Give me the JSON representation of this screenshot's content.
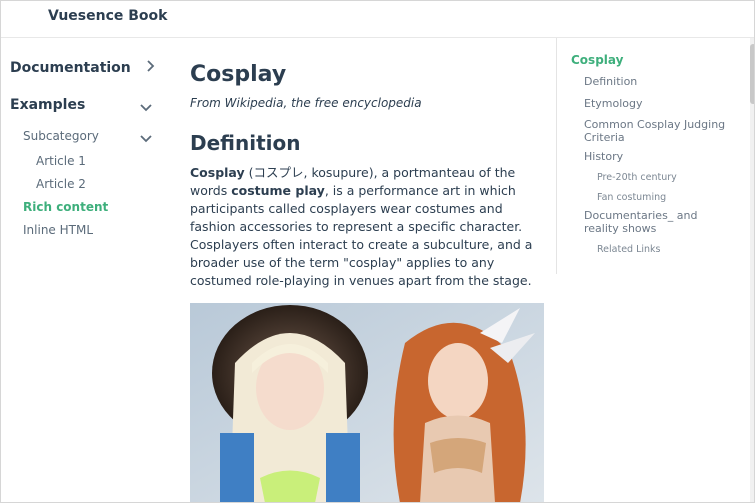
{
  "app": {
    "title": "Vuesence Book"
  },
  "sidebar": {
    "documentation": "Documentation",
    "examples": "Examples",
    "subcategory": "Subcategory",
    "article1": "Article 1",
    "article2": "Article 2",
    "rich_content": "Rich content",
    "inline_html": "Inline HTML"
  },
  "content": {
    "title": "Cosplay",
    "subtitle": "From Wikipedia, the free encyclopedia",
    "heading": "Definition",
    "p_bold1": "Cosplay",
    "p_text1": " (コスプレ, kosupure), a portmanteau of the words ",
    "p_bold2": "costume play",
    "p_text2": ", is a performance art in which participants called cosplayers wear costumes and fashion accessories to represent a specific character. Cosplayers often interact to create a subculture, and a broader use of the term \"cosplay\" applies to any costumed role-playing in venues apart from the stage."
  },
  "toc": {
    "cosplay": "Cosplay",
    "definition": "Definition",
    "etymology": "Etymology",
    "judging": "Common Cosplay Judging Criteria",
    "history": "History",
    "pre20": "Pre-20th century",
    "fan": "Fan costuming",
    "docs": "Documentaries_ and reality shows",
    "related": "Related Links"
  },
  "colors": {
    "accent": "#3eaf7c",
    "text": "#2c3e50",
    "muted": "#6b7785"
  }
}
